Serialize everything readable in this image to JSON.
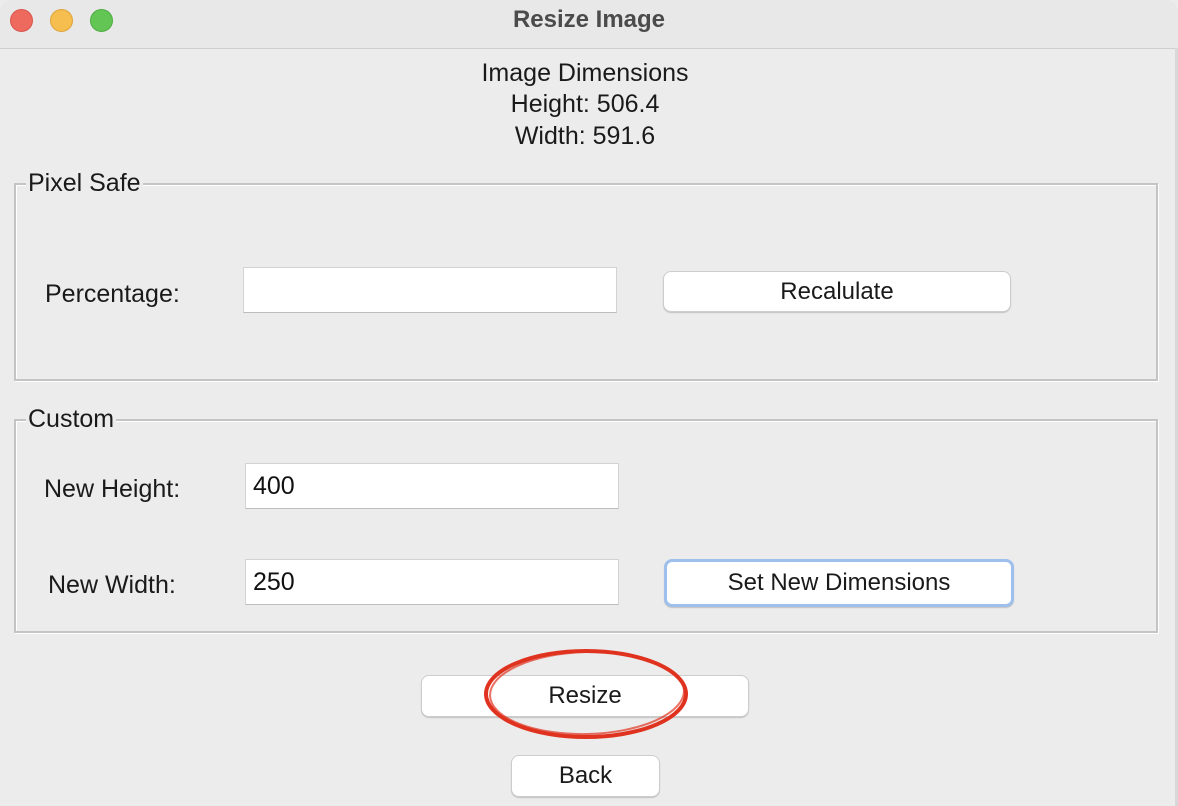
{
  "window": {
    "title": "Resize Image"
  },
  "info": {
    "heading": "Image Dimensions",
    "height_text": "Height: 506.4",
    "width_text": "Width: 591.6"
  },
  "pixel_safe": {
    "title": "Pixel Safe",
    "percentage_label": "Percentage:",
    "percentage_value": "",
    "recalculate_label": "Recalulate"
  },
  "custom": {
    "title": "Custom",
    "new_height_label": "New Height:",
    "new_height_value": "400",
    "new_width_label": "New Width:",
    "new_width_value": "250",
    "set_dimensions_label": "Set New Dimensions"
  },
  "actions": {
    "resize_label": "Resize",
    "back_label": "Back"
  },
  "colors": {
    "annotation": "#e0331f",
    "focus_ring": "#9fc0ec",
    "close": "#ee6a5f",
    "minimize": "#f5be4f",
    "maximize": "#62c554"
  }
}
